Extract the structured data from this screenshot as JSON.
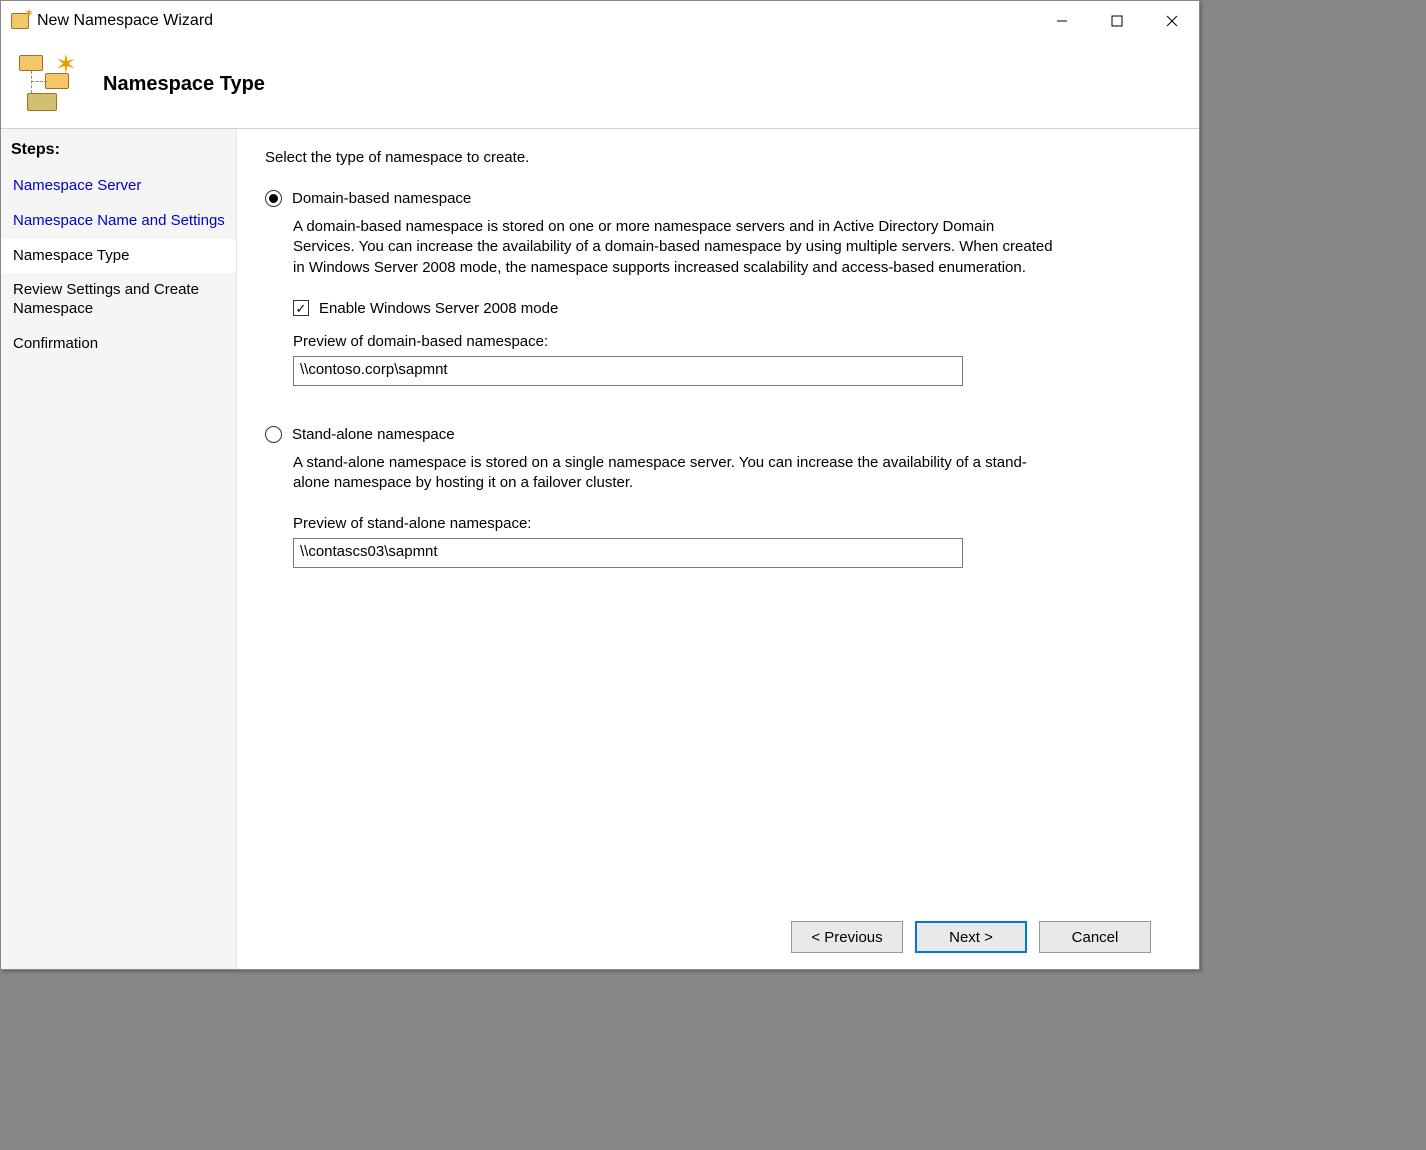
{
  "window": {
    "title": "New Namespace Wizard"
  },
  "header": {
    "page_title": "Namespace Type"
  },
  "sidebar": {
    "steps_label": "Steps:",
    "items": [
      {
        "label": "Namespace Server"
      },
      {
        "label": "Namespace Name and Settings"
      },
      {
        "label": "Namespace Type"
      },
      {
        "label": "Review Settings and Create Namespace"
      },
      {
        "label": "Confirmation"
      }
    ]
  },
  "content": {
    "instruction": "Select the type of namespace to create.",
    "option1": {
      "label": "Domain-based namespace",
      "description": "A domain-based namespace is stored on one or more namespace servers and in Active Directory Domain Services. You can increase the availability of a domain-based namespace by using multiple servers. When created in Windows Server 2008 mode, the namespace supports increased scalability and access-based enumeration.",
      "checkbox_label": "Enable Windows Server 2008 mode",
      "preview_label": "Preview of domain-based namespace:",
      "preview_value": "\\\\contoso.corp\\sapmnt"
    },
    "option2": {
      "label": "Stand-alone namespace",
      "description": "A stand-alone namespace is stored on a single namespace server. You can increase the availability of a stand-alone namespace by hosting it on a failover cluster.",
      "preview_label": "Preview of stand-alone namespace:",
      "preview_value": "\\\\contascs03\\sapmnt"
    }
  },
  "footer": {
    "previous": "< Previous",
    "next": "Next >",
    "cancel": "Cancel"
  }
}
